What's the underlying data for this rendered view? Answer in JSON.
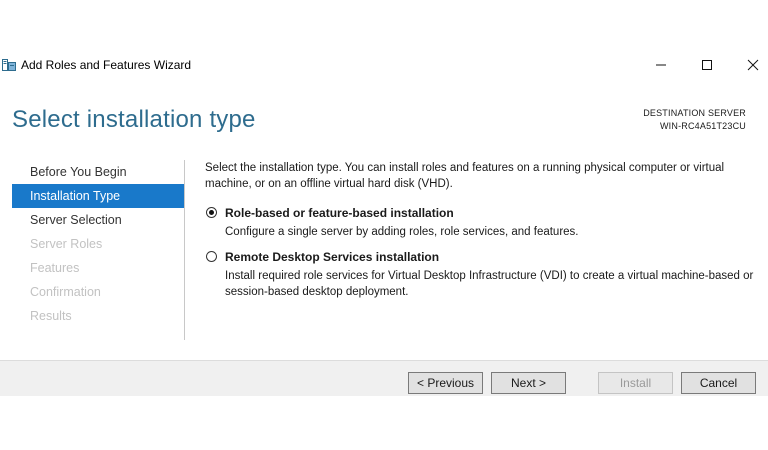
{
  "window": {
    "title": "Add Roles and Features Wizard",
    "icon": "server-manager-icon"
  },
  "header": {
    "page_title": "Select installation type",
    "destination_label": "DESTINATION SERVER",
    "destination_server": "WIN-RC4A51T23CU"
  },
  "nav": {
    "items": [
      {
        "label": "Before You Begin",
        "state": "normal"
      },
      {
        "label": "Installation Type",
        "state": "active"
      },
      {
        "label": "Server Selection",
        "state": "normal"
      },
      {
        "label": "Server Roles",
        "state": "disabled"
      },
      {
        "label": "Features",
        "state": "disabled"
      },
      {
        "label": "Confirmation",
        "state": "disabled"
      },
      {
        "label": "Results",
        "state": "disabled"
      }
    ]
  },
  "content": {
    "intro": "Select the installation type. You can install roles and features on a running physical computer or virtual machine, or on an offline virtual hard disk (VHD).",
    "options": [
      {
        "title": "Role-based or feature-based installation",
        "description": "Configure a single server by adding roles, role services, and features.",
        "selected": true
      },
      {
        "title": "Remote Desktop Services installation",
        "description": "Install required role services for Virtual Desktop Infrastructure (VDI) to create a virtual machine-based or session-based desktop deployment.",
        "selected": false
      }
    ]
  },
  "buttons": {
    "previous": "< Previous",
    "next": "Next >",
    "install": "Install",
    "cancel": "Cancel"
  },
  "colors": {
    "accent": "#1979ca",
    "title": "#2e6c8e",
    "disabled": "#c2c2c2"
  }
}
